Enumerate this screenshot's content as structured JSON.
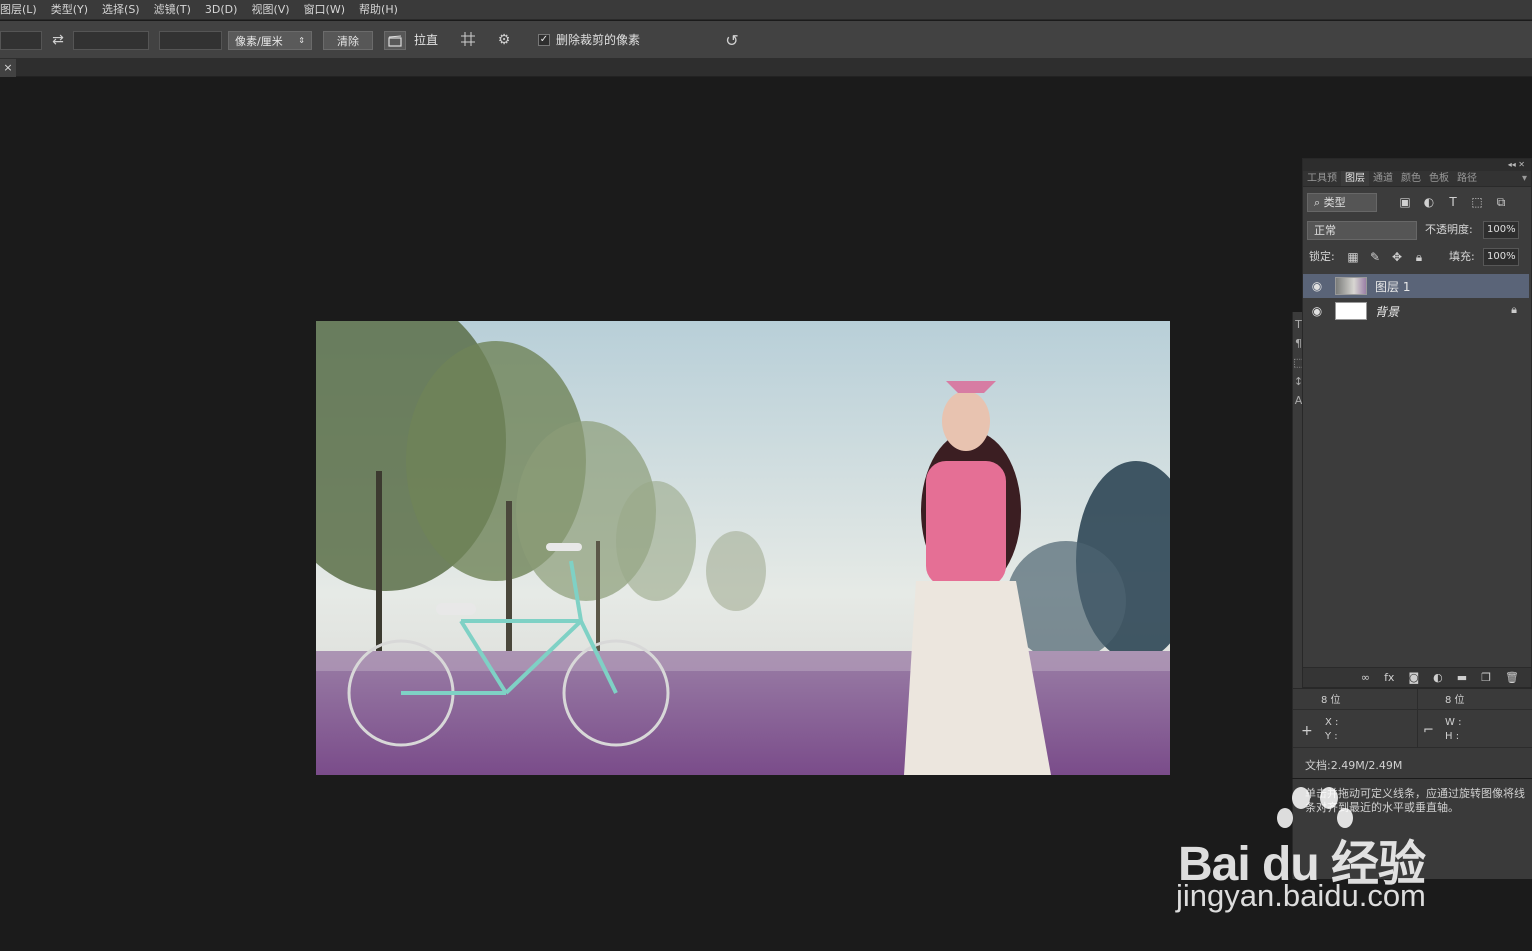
{
  "menubar": {
    "items": [
      "图层(L)",
      "类型(Y)",
      "选择(S)",
      "滤镜(T)",
      "3D(D)",
      "视图(V)",
      "窗口(W)",
      "帮助(H)"
    ]
  },
  "options": {
    "unit_select": "像素/厘米",
    "clear_button": "清除",
    "straighten_label": "拉直",
    "delete_cropped_label": "删除裁剪的像素",
    "delete_cropped_checked": true
  },
  "tab": {
    "close_glyph": "×"
  },
  "layers_panel": {
    "tabs": [
      "工具预",
      "图层",
      "通道",
      "颜色",
      "色板",
      "路径"
    ],
    "active_tab": "图层",
    "filter_select": "类型",
    "blend_select": "正常",
    "opacity_label": "不透明度:",
    "opacity_value": "100%",
    "lock_label": "锁定:",
    "fill_label": "填充:",
    "fill_value": "100%",
    "layers": [
      {
        "name": "图层 1",
        "selected": true,
        "locked": false
      },
      {
        "name": "背景",
        "selected": false,
        "locked": true
      }
    ],
    "footer_icons": [
      "link-icon",
      "fx-icon",
      "mask-icon",
      "adjustment-icon",
      "folder-icon",
      "new-layer-icon",
      "trash-icon"
    ]
  },
  "info_panel": {
    "bits_left": "8 位",
    "bits_right": "8 位",
    "x_label": "X :",
    "y_label": "Y :",
    "w_label": "W :",
    "h_label": "H :",
    "doc_size": "文档:2.49M/2.49M"
  },
  "hint": {
    "text": "单击并拖动可定义线条，应通过旋转图像将线条对齐到最近的水平或垂直轴。"
  },
  "watermark": {
    "brand": "Bai du 经验",
    "url": "jingyan.baidu.com"
  }
}
